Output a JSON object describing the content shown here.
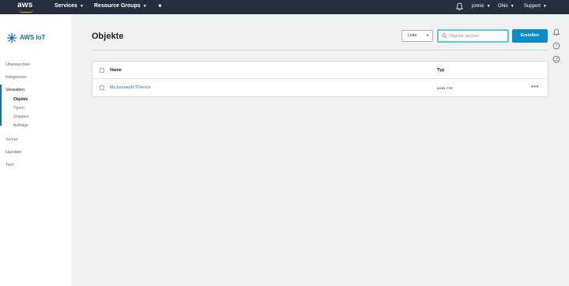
{
  "topnav": {
    "logo_text": "aws",
    "services": "Services",
    "resource_groups": "Resource Groups",
    "user": "jonnic",
    "region": "Ohio",
    "support": "Support"
  },
  "sidebar": {
    "brand": "AWS IoT",
    "items": [
      {
        "label": "Überwachen"
      },
      {
        "label": "Integrieren"
      },
      {
        "label": "Verwalten"
      },
      {
        "label": "Sicher"
      },
      {
        "label": "Handeln"
      },
      {
        "label": "Test"
      }
    ],
    "subitems": [
      {
        "label": "Objekte"
      },
      {
        "label": "Typen"
      },
      {
        "label": "Gruppen"
      },
      {
        "label": "Aufträge"
      }
    ]
  },
  "main": {
    "title": "Objekte",
    "view_select": "Liste",
    "search_placeholder": "Objekte suchen",
    "create_button": "Erstellen",
    "table": {
      "headers": [
        "Name",
        "Typ"
      ],
      "rows": [
        {
          "name": "MyJourneyIoTDevice",
          "type": "KEIN TYP",
          "actions": "•••"
        }
      ]
    }
  },
  "colors": {
    "nav_bg": "#232f3e",
    "accent": "#ff9900",
    "primary": "#0d8bc4",
    "link": "#0d7fb8",
    "search_focus": "#5ac8d8"
  }
}
